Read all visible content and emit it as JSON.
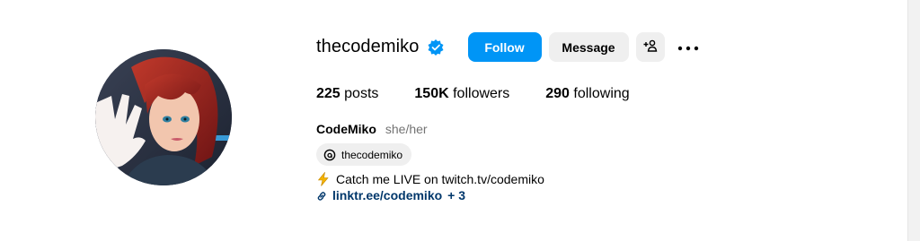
{
  "profile": {
    "username": "thecodemiko",
    "verified": true,
    "full_name": "CodeMiko",
    "pronouns": "she/her",
    "threads_handle": "thecodemiko",
    "bio": "Catch me LIVE on twitch.tv/codemiko",
    "link": "linktr.ee/codemiko",
    "link_extra": "+ 3"
  },
  "actions": {
    "follow_label": "Follow",
    "message_label": "Message"
  },
  "stats": {
    "posts_count": "225",
    "posts_label": "posts",
    "followers_count": "150K",
    "followers_label": "followers",
    "following_count": "290",
    "following_label": "following"
  },
  "icons": {
    "verified": "verified-badge-icon",
    "suggest": "person-add-icon",
    "more": "more-options-icon",
    "threads": "threads-icon",
    "bio_emoji": "lightning-bolt-icon",
    "link": "link-icon"
  },
  "colors": {
    "primary_button": "#0095f6",
    "secondary_button": "#efefef",
    "link": "#00376b",
    "muted_text": "#737373",
    "verified_badge": "#0095f6"
  }
}
